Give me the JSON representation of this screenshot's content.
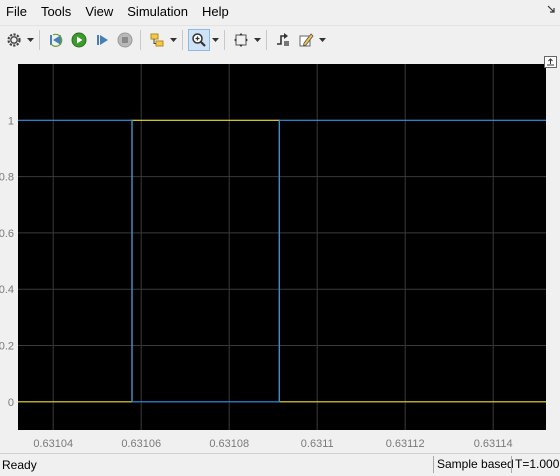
{
  "menu": {
    "file": "File",
    "tools": "Tools",
    "view": "View",
    "simulation": "Simulation",
    "help": "Help"
  },
  "toolbar": {
    "icons": [
      "gear-icon",
      "step-back-icon",
      "run-icon",
      "step-forward-icon",
      "stop-icon",
      "highlight-signal-icon",
      "zoom-icon",
      "fit-to-view-icon",
      "triggers-icon",
      "style-icon"
    ]
  },
  "chart_data": {
    "type": "line",
    "xlim": [
      0.631032,
      0.631152
    ],
    "ylim": [
      -0.1,
      1.2
    ],
    "xticks": [
      0.63104,
      0.63106,
      0.63108,
      0.6311,
      0.63112,
      0.63114
    ],
    "xtick_labels": [
      "0.63104",
      "0.63106",
      "0.63108",
      "0.6311",
      "0.63112",
      "0.63114"
    ],
    "yticks": [
      0,
      0.2,
      0.4,
      0.6,
      0.8,
      1
    ],
    "ytick_labels": [
      "0",
      "0.2",
      "0.4",
      "0.6",
      "0.8",
      "1"
    ],
    "grid": true,
    "background": "#000000",
    "series": [
      {
        "color": "#e8d92b",
        "x": [
          0.631032,
          0.6310579,
          0.6310579,
          0.6310914,
          0.6310914,
          0.631152
        ],
        "y": [
          0,
          0,
          1,
          1,
          0,
          0
        ]
      },
      {
        "color": "#2f8fe0",
        "x": [
          0.631032,
          0.6310579,
          0.6310579,
          0.6310914,
          0.6310914,
          0.631152
        ],
        "y": [
          1,
          1,
          0,
          0,
          1,
          1
        ]
      }
    ]
  },
  "status": {
    "ready": "Ready",
    "sample_mode": "Sample based",
    "time": "T=1.000"
  }
}
